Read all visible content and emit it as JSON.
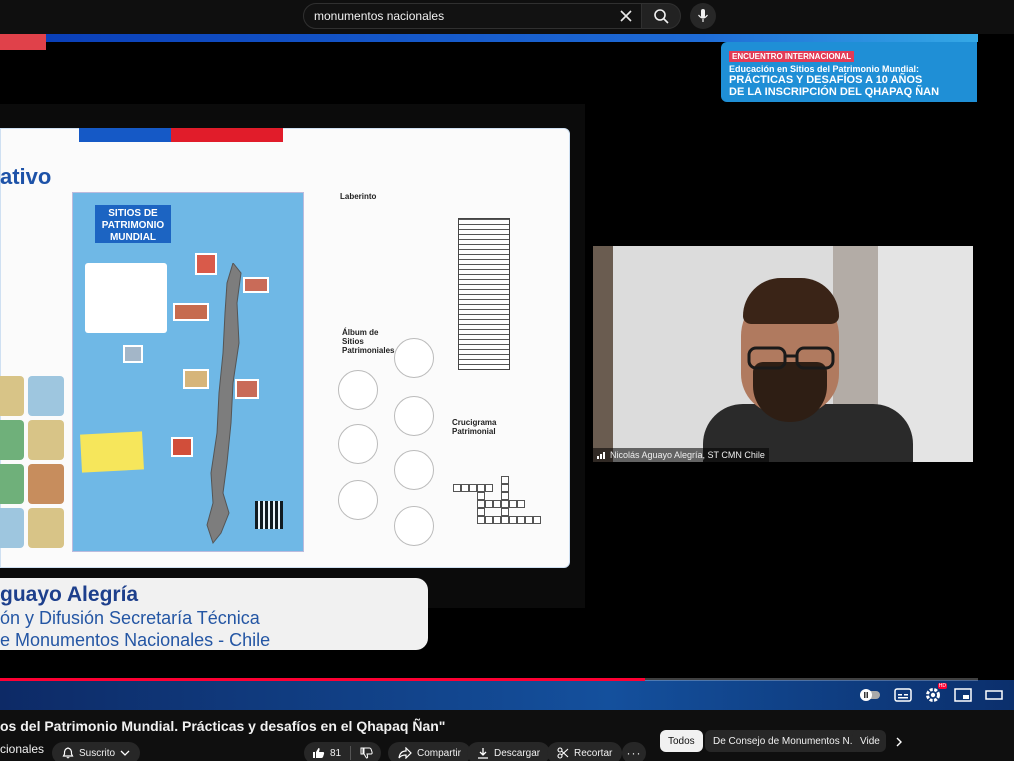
{
  "search": {
    "query": "monumentos nacionales"
  },
  "banner": {
    "tag": "ENCUENTRO INTERNACIONAL",
    "line2": "Educación en Sitios del Patrimonio Mundial:",
    "line3": "PRÁCTICAS Y DESAFÍOS A 10 AÑOS",
    "line4": "DE LA INSCRIPCIÓN DEL QHAPAQ ÑAN"
  },
  "slide": {
    "title": "ativo",
    "poster_title_1": "SITIOS DE",
    "poster_title_2": "PATRIMONIO",
    "poster_title_3": "MUNDIAL",
    "ws_labyrinth": "Laberinto",
    "ws_album_1": "Álbum de",
    "ws_album_2": "Sitios",
    "ws_album_3": "Patrimoniales",
    "ws_cross_1": "Crucigrama",
    "ws_cross_2": "Patrimonial"
  },
  "lower_third": {
    "name": "guayo Alegría",
    "role": "ón y Difusión Secretaría Técnica",
    "org": "e Monumentos Nacionales - Chile"
  },
  "webcam": {
    "participant": "Nicolás Aguayo Alegría, ST CMN Chile"
  },
  "player": {
    "progress": 0.66,
    "hd_badge": "HD"
  },
  "video": {
    "title": "os del Patrimonio Mundial. Prácticas y desafíos en el Qhapaq Ñan\"",
    "channel": "cionales",
    "subscribed_label": "Suscrito",
    "likes": "81",
    "share_label": "Compartir",
    "download_label": "Descargar",
    "clip_label": "Recortar"
  },
  "chips": [
    {
      "label": "Todos"
    },
    {
      "label": "De Consejo de Monumentos N..."
    },
    {
      "label": "Vide"
    }
  ],
  "colors": {
    "accent_red": "#ff0033",
    "banner_blue": "#1f8fd6",
    "tag_pink": "#e23b56",
    "slide_blue": "#1d52a8"
  }
}
